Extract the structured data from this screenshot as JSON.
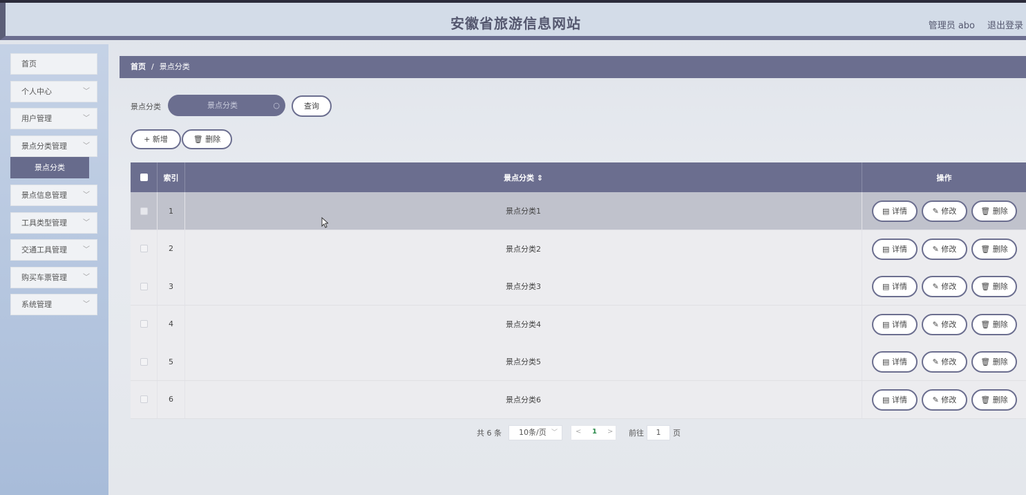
{
  "header": {
    "title": "安徽省旅游信息网站",
    "user": "管理员 abo",
    "logout": "退出登录"
  },
  "sidebar": {
    "items": [
      {
        "label": "首页"
      },
      {
        "label": "个人中心"
      },
      {
        "label": "用户管理"
      },
      {
        "label": "景点分类管理"
      },
      {
        "label": "景点信息管理"
      },
      {
        "label": "工具类型管理"
      },
      {
        "label": "交通工具管理"
      },
      {
        "label": "购买车票管理"
      },
      {
        "label": "系统管理"
      }
    ],
    "sub_active": "景点分类",
    "chevron": "chevron-down-icon"
  },
  "breadcrumb": {
    "home": "首页",
    "sep": "/",
    "current": "景点分类"
  },
  "search": {
    "label": "景点分类",
    "placeholder": "景点分类",
    "button": "查询"
  },
  "toolbar": {
    "add": "+ 新增",
    "delete": "删除"
  },
  "table": {
    "headers": {
      "index": "索引",
      "category": "景点分类 ⇕",
      "ops": "操作"
    },
    "rows": [
      {
        "index": "1",
        "category": "景点分类1"
      },
      {
        "index": "2",
        "category": "景点分类2"
      },
      {
        "index": "3",
        "category": "景点分类3"
      },
      {
        "index": "4",
        "category": "景点分类4"
      },
      {
        "index": "5",
        "category": "景点分类5"
      },
      {
        "index": "6",
        "category": "景点分类6"
      }
    ],
    "ops": {
      "detail": "详情",
      "edit": "修改",
      "delete": "删除"
    }
  },
  "pager": {
    "total": "共 6 条",
    "page_size": "10条/页",
    "prev": "<",
    "current": "1",
    "next": ">",
    "goto": "前往",
    "goto_value": "1",
    "unit": "页"
  },
  "colors": {
    "accent": "#6b6e8f",
    "header_bg": "#d3dce8",
    "sidebar": "#a8bcd9"
  }
}
